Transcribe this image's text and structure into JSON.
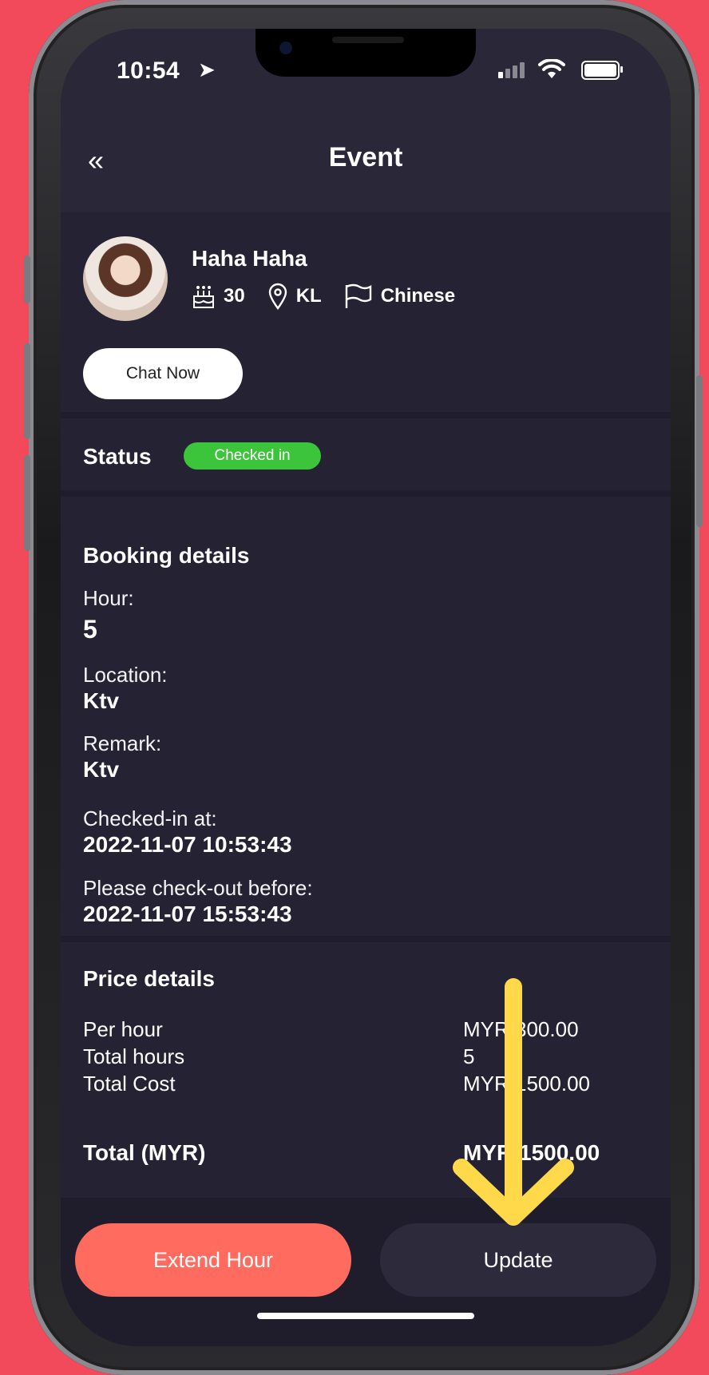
{
  "status_bar": {
    "time": "10:54",
    "location_icon": "navigation-arrow-icon",
    "signal_icon": "cell-signal-icon",
    "wifi_icon": "wifi-icon",
    "battery_icon": "battery-icon"
  },
  "nav": {
    "back_icon": "double-chevron-left-icon",
    "title": "Event"
  },
  "profile": {
    "name": "Haha Haha",
    "age": "30",
    "location": "KL",
    "language": "Chinese",
    "chat_button": "Chat Now"
  },
  "status": {
    "label": "Status",
    "badge": "Checked in",
    "badge_color": "#3cc43a"
  },
  "booking": {
    "title": "Booking details",
    "hour_label": "Hour:",
    "hour_value": "5",
    "location_label": "Location:",
    "location_value": "Ktv",
    "remark_label": "Remark:",
    "remark_value": "Ktv",
    "checked_in_label": "Checked-in at:",
    "checked_in_value": "2022-11-07 10:53:43",
    "checkout_label": "Please check-out before:",
    "checkout_value": "2022-11-07 15:53:43"
  },
  "price": {
    "title": "Price details",
    "rows": [
      {
        "label": "Per hour",
        "value": "MYR 300.00"
      },
      {
        "label": "Total hours",
        "value": "5"
      },
      {
        "label": "Total Cost",
        "value": "MYR 1500.00"
      }
    ],
    "total_label": "Total (MYR)",
    "total_value": "MYR 1500.00"
  },
  "actions": {
    "extend": "Extend Hour",
    "update": "Update"
  },
  "colors": {
    "background": "#f24a5a",
    "screen": "#1f1d2c",
    "extend_button": "#ff6b5e",
    "annotation_arrow": "#ffd94a"
  }
}
